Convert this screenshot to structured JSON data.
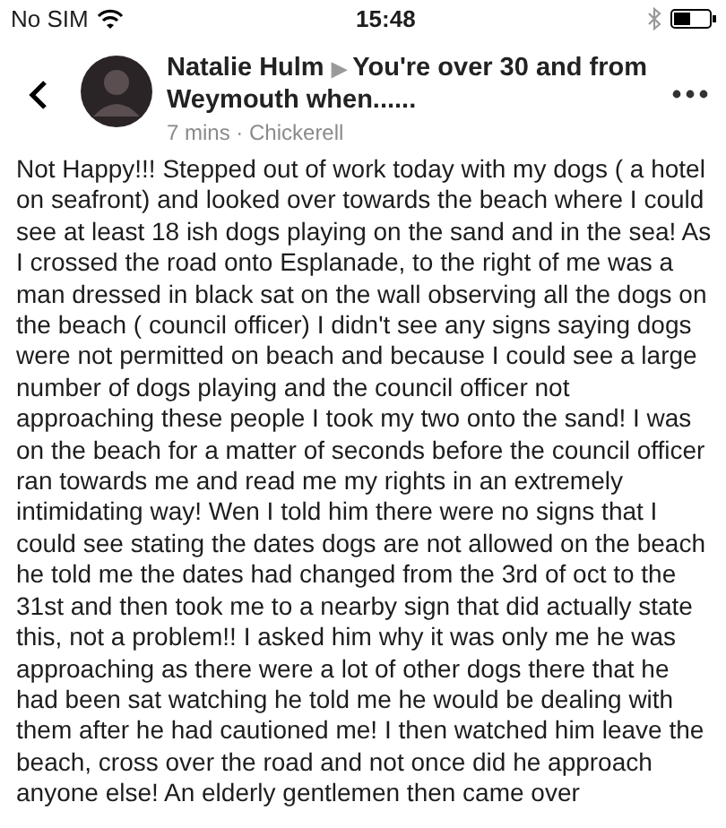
{
  "status_bar": {
    "carrier": "No SIM",
    "time": "15:48"
  },
  "post": {
    "author": "Natalie Hulm",
    "separator": "▶",
    "group": "You're over 30 and from Weymouth when......",
    "meta": "7 mins · Chickerell",
    "body": "Not Happy!!! Stepped out of work today with my dogs ( a hotel on seafront) and looked over towards the beach where I could see at least 18 ish dogs playing on the sand and in the sea! As I crossed the road onto Esplanade, to the right of me was a man dressed in black sat on the wall observing all the dogs on the beach ( council officer) I didn't see any signs saying dogs were not permitted on beach and because I could see a large number of dogs playing and the council officer not approaching these people I took my two onto the sand! I was on the beach for a matter of seconds before the council officer ran towards me and read me my rights in an extremely intimidating way! Wen I told him there were no signs that I could see stating the dates dogs are not allowed on the beach he told me the dates had changed from the 3rd of oct to the 31st and then took me to a nearby sign that did actually state this, not a problem!! I asked him why it was only me he was approaching as there were a lot of other dogs there that he had been sat watching he told me he would be dealing with them after he had cautioned me! I then watched him leave the beach, cross over the road and not once did he approach anyone else! An elderly gentlemen then came over"
  }
}
